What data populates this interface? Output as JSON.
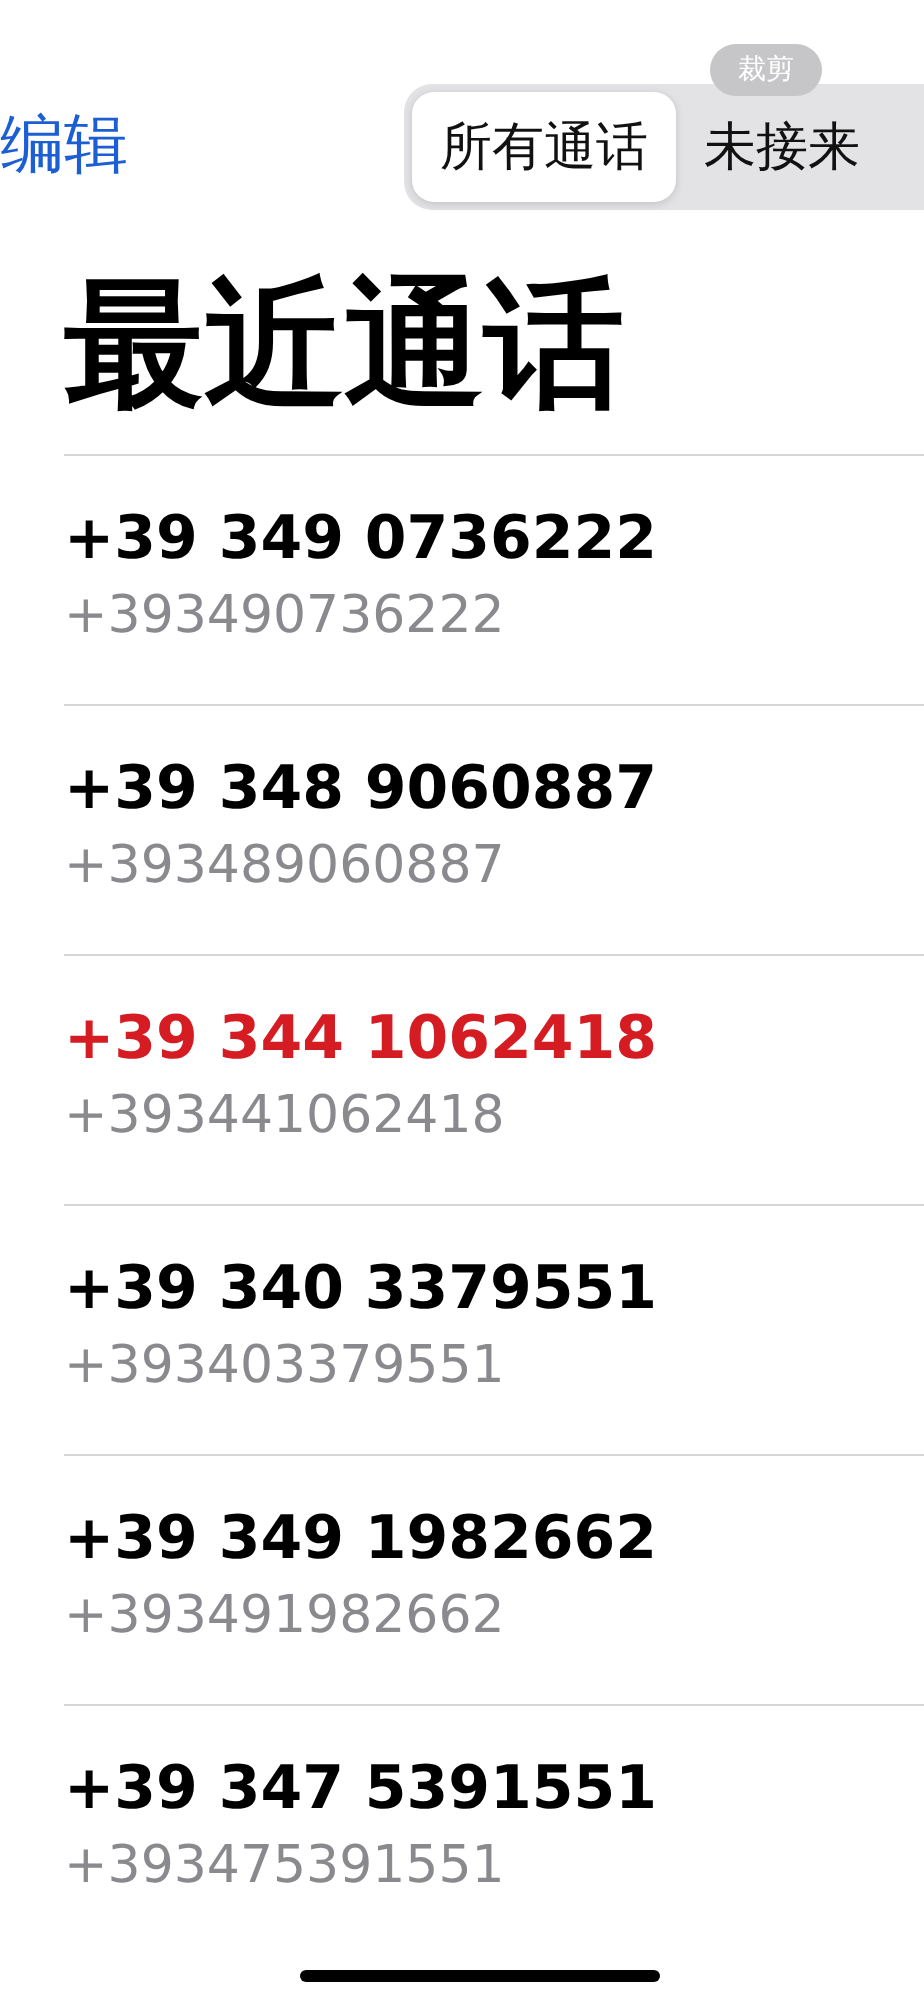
{
  "nav": {
    "edit": "编辑",
    "segments": [
      {
        "label": "所有通话",
        "selected": true
      },
      {
        "label": "未接来",
        "selected": false
      }
    ],
    "overlay_badge": "裁剪"
  },
  "title": "最近通话",
  "calls": [
    {
      "name": "+39 349 0736222",
      "detail": "+393490736222",
      "missed": false
    },
    {
      "name": "+39 348 9060887",
      "detail": "+393489060887",
      "missed": false
    },
    {
      "name": "+39 344 1062418",
      "detail": "+393441062418",
      "missed": true
    },
    {
      "name": "+39 340 3379551",
      "detail": "+393403379551",
      "missed": false
    },
    {
      "name": "+39 349 1982662",
      "detail": "+393491982662",
      "missed": false
    },
    {
      "name": "+39 347 5391551",
      "detail": "+393475391551",
      "missed": false
    }
  ]
}
